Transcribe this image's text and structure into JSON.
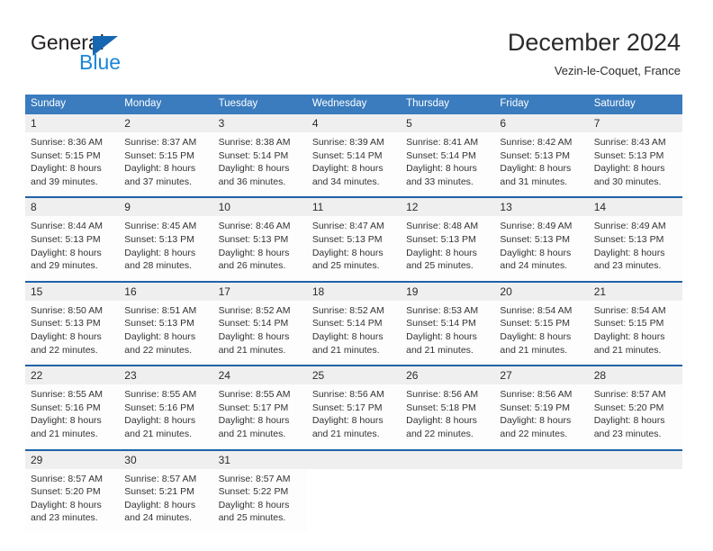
{
  "brand": {
    "name_part1": "General",
    "name_part2": "Blue",
    "triangle_icon": "triangle-icon",
    "accent_dark": "#231f20",
    "accent_blue": "#1a86d8",
    "triangle_blue": "#1667b2"
  },
  "header": {
    "title": "December 2024",
    "location": "Vezin-le-Coquet, France"
  },
  "colors": {
    "header_row_bg": "#3a7cbe",
    "week_separator": "#1f63a8",
    "daynum_bg": "#efefef",
    "text": "#333333"
  },
  "weekdays": [
    "Sunday",
    "Monday",
    "Tuesday",
    "Wednesday",
    "Thursday",
    "Friday",
    "Saturday"
  ],
  "weeks": [
    [
      {
        "day": "1",
        "sunrise": "Sunrise: 8:36 AM",
        "sunset": "Sunset: 5:15 PM",
        "daylight_1": "Daylight: 8 hours",
        "daylight_2": "and 39 minutes."
      },
      {
        "day": "2",
        "sunrise": "Sunrise: 8:37 AM",
        "sunset": "Sunset: 5:15 PM",
        "daylight_1": "Daylight: 8 hours",
        "daylight_2": "and 37 minutes."
      },
      {
        "day": "3",
        "sunrise": "Sunrise: 8:38 AM",
        "sunset": "Sunset: 5:14 PM",
        "daylight_1": "Daylight: 8 hours",
        "daylight_2": "and 36 minutes."
      },
      {
        "day": "4",
        "sunrise": "Sunrise: 8:39 AM",
        "sunset": "Sunset: 5:14 PM",
        "daylight_1": "Daylight: 8 hours",
        "daylight_2": "and 34 minutes."
      },
      {
        "day": "5",
        "sunrise": "Sunrise: 8:41 AM",
        "sunset": "Sunset: 5:14 PM",
        "daylight_1": "Daylight: 8 hours",
        "daylight_2": "and 33 minutes."
      },
      {
        "day": "6",
        "sunrise": "Sunrise: 8:42 AM",
        "sunset": "Sunset: 5:13 PM",
        "daylight_1": "Daylight: 8 hours",
        "daylight_2": "and 31 minutes."
      },
      {
        "day": "7",
        "sunrise": "Sunrise: 8:43 AM",
        "sunset": "Sunset: 5:13 PM",
        "daylight_1": "Daylight: 8 hours",
        "daylight_2": "and 30 minutes."
      }
    ],
    [
      {
        "day": "8",
        "sunrise": "Sunrise: 8:44 AM",
        "sunset": "Sunset: 5:13 PM",
        "daylight_1": "Daylight: 8 hours",
        "daylight_2": "and 29 minutes."
      },
      {
        "day": "9",
        "sunrise": "Sunrise: 8:45 AM",
        "sunset": "Sunset: 5:13 PM",
        "daylight_1": "Daylight: 8 hours",
        "daylight_2": "and 28 minutes."
      },
      {
        "day": "10",
        "sunrise": "Sunrise: 8:46 AM",
        "sunset": "Sunset: 5:13 PM",
        "daylight_1": "Daylight: 8 hours",
        "daylight_2": "and 26 minutes."
      },
      {
        "day": "11",
        "sunrise": "Sunrise: 8:47 AM",
        "sunset": "Sunset: 5:13 PM",
        "daylight_1": "Daylight: 8 hours",
        "daylight_2": "and 25 minutes."
      },
      {
        "day": "12",
        "sunrise": "Sunrise: 8:48 AM",
        "sunset": "Sunset: 5:13 PM",
        "daylight_1": "Daylight: 8 hours",
        "daylight_2": "and 25 minutes."
      },
      {
        "day": "13",
        "sunrise": "Sunrise: 8:49 AM",
        "sunset": "Sunset: 5:13 PM",
        "daylight_1": "Daylight: 8 hours",
        "daylight_2": "and 24 minutes."
      },
      {
        "day": "14",
        "sunrise": "Sunrise: 8:49 AM",
        "sunset": "Sunset: 5:13 PM",
        "daylight_1": "Daylight: 8 hours",
        "daylight_2": "and 23 minutes."
      }
    ],
    [
      {
        "day": "15",
        "sunrise": "Sunrise: 8:50 AM",
        "sunset": "Sunset: 5:13 PM",
        "daylight_1": "Daylight: 8 hours",
        "daylight_2": "and 22 minutes."
      },
      {
        "day": "16",
        "sunrise": "Sunrise: 8:51 AM",
        "sunset": "Sunset: 5:13 PM",
        "daylight_1": "Daylight: 8 hours",
        "daylight_2": "and 22 minutes."
      },
      {
        "day": "17",
        "sunrise": "Sunrise: 8:52 AM",
        "sunset": "Sunset: 5:14 PM",
        "daylight_1": "Daylight: 8 hours",
        "daylight_2": "and 21 minutes."
      },
      {
        "day": "18",
        "sunrise": "Sunrise: 8:52 AM",
        "sunset": "Sunset: 5:14 PM",
        "daylight_1": "Daylight: 8 hours",
        "daylight_2": "and 21 minutes."
      },
      {
        "day": "19",
        "sunrise": "Sunrise: 8:53 AM",
        "sunset": "Sunset: 5:14 PM",
        "daylight_1": "Daylight: 8 hours",
        "daylight_2": "and 21 minutes."
      },
      {
        "day": "20",
        "sunrise": "Sunrise: 8:54 AM",
        "sunset": "Sunset: 5:15 PM",
        "daylight_1": "Daylight: 8 hours",
        "daylight_2": "and 21 minutes."
      },
      {
        "day": "21",
        "sunrise": "Sunrise: 8:54 AM",
        "sunset": "Sunset: 5:15 PM",
        "daylight_1": "Daylight: 8 hours",
        "daylight_2": "and 21 minutes."
      }
    ],
    [
      {
        "day": "22",
        "sunrise": "Sunrise: 8:55 AM",
        "sunset": "Sunset: 5:16 PM",
        "daylight_1": "Daylight: 8 hours",
        "daylight_2": "and 21 minutes."
      },
      {
        "day": "23",
        "sunrise": "Sunrise: 8:55 AM",
        "sunset": "Sunset: 5:16 PM",
        "daylight_1": "Daylight: 8 hours",
        "daylight_2": "and 21 minutes."
      },
      {
        "day": "24",
        "sunrise": "Sunrise: 8:55 AM",
        "sunset": "Sunset: 5:17 PM",
        "daylight_1": "Daylight: 8 hours",
        "daylight_2": "and 21 minutes."
      },
      {
        "day": "25",
        "sunrise": "Sunrise: 8:56 AM",
        "sunset": "Sunset: 5:17 PM",
        "daylight_1": "Daylight: 8 hours",
        "daylight_2": "and 21 minutes."
      },
      {
        "day": "26",
        "sunrise": "Sunrise: 8:56 AM",
        "sunset": "Sunset: 5:18 PM",
        "daylight_1": "Daylight: 8 hours",
        "daylight_2": "and 22 minutes."
      },
      {
        "day": "27",
        "sunrise": "Sunrise: 8:56 AM",
        "sunset": "Sunset: 5:19 PM",
        "daylight_1": "Daylight: 8 hours",
        "daylight_2": "and 22 minutes."
      },
      {
        "day": "28",
        "sunrise": "Sunrise: 8:57 AM",
        "sunset": "Sunset: 5:20 PM",
        "daylight_1": "Daylight: 8 hours",
        "daylight_2": "and 23 minutes."
      }
    ],
    [
      {
        "day": "29",
        "sunrise": "Sunrise: 8:57 AM",
        "sunset": "Sunset: 5:20 PM",
        "daylight_1": "Daylight: 8 hours",
        "daylight_2": "and 23 minutes."
      },
      {
        "day": "30",
        "sunrise": "Sunrise: 8:57 AM",
        "sunset": "Sunset: 5:21 PM",
        "daylight_1": "Daylight: 8 hours",
        "daylight_2": "and 24 minutes."
      },
      {
        "day": "31",
        "sunrise": "Sunrise: 8:57 AM",
        "sunset": "Sunset: 5:22 PM",
        "daylight_1": "Daylight: 8 hours",
        "daylight_2": "and 25 minutes."
      },
      {
        "day": "",
        "sunrise": "",
        "sunset": "",
        "daylight_1": "",
        "daylight_2": ""
      },
      {
        "day": "",
        "sunrise": "",
        "sunset": "",
        "daylight_1": "",
        "daylight_2": ""
      },
      {
        "day": "",
        "sunrise": "",
        "sunset": "",
        "daylight_1": "",
        "daylight_2": ""
      },
      {
        "day": "",
        "sunrise": "",
        "sunset": "",
        "daylight_1": "",
        "daylight_2": ""
      }
    ]
  ]
}
